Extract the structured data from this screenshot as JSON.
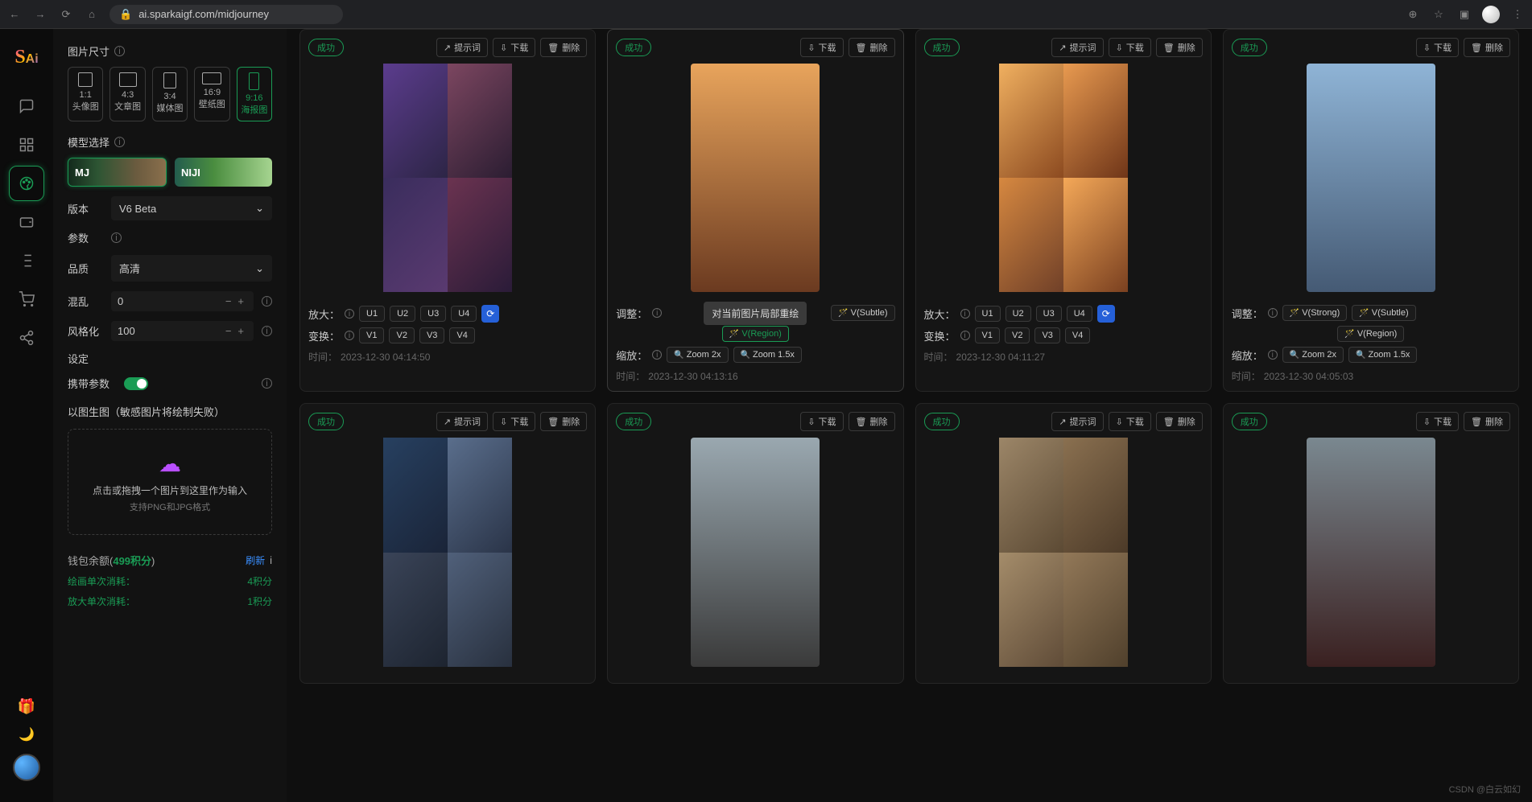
{
  "browser": {
    "url": "ai.sparkaigf.com/midjourney"
  },
  "sidebar": {
    "size_label": "图片尺寸",
    "sizes": [
      {
        "ratio": "1:1",
        "label": "头像图"
      },
      {
        "ratio": "4:3",
        "label": "文章图"
      },
      {
        "ratio": "3:4",
        "label": "媒体图"
      },
      {
        "ratio": "16:9",
        "label": "壁纸图"
      },
      {
        "ratio": "9:16",
        "label": "海报图"
      }
    ],
    "model_label": "模型选择",
    "models": {
      "mj": "MJ",
      "niji": "NIJI"
    },
    "version_label": "版本",
    "version_value": "V6 Beta",
    "params_label": "参数",
    "quality_label": "品质",
    "quality_value": "高清",
    "chaos_label": "混乱",
    "chaos_value": "0",
    "style_label": "风格化",
    "style_value": "100",
    "settings_label": "设定",
    "carry_label": "携带参数",
    "img2img_label": "以图生图（敏感图片将绘制失败）",
    "upload_l1": "点击或拖拽一个图片到这里作为输入",
    "upload_l2": "支持PNG和JPG格式",
    "wallet_label": "钱包余额(",
    "wallet_points": "499积分",
    "wallet_close": ")",
    "refresh": "刷新",
    "cost_draw_label": "绘画单次消耗：",
    "cost_draw_val": "4积分",
    "cost_upscale_label": "放大单次消耗：",
    "cost_upscale_val": "1积分"
  },
  "labels": {
    "success": "成功",
    "prompt": "提示词",
    "download": "下载",
    "delete": "删除",
    "upscale": "放大：",
    "variation": "变换：",
    "adjust": "调整：",
    "zoom": "缩放：",
    "time": "时间：",
    "u1": "U1",
    "u2": "U2",
    "u3": "U3",
    "u4": "U4",
    "v1": "V1",
    "v2": "V2",
    "v3": "V3",
    "v4": "V4",
    "vstrong": "V(Strong)",
    "vsubtle": "V(Subtle)",
    "vregion": "V(Region)",
    "zoom2": "Zoom 2x",
    "zoom15": "Zoom 1.5x",
    "tooltip_region": "对当前图片局部重绘"
  },
  "cards": [
    {
      "type": "grid",
      "actions": [
        "prompt",
        "download",
        "delete"
      ],
      "controls": "upscale",
      "time": "2023-12-30 04:14:50"
    },
    {
      "type": "single",
      "actions": [
        "download",
        "delete"
      ],
      "controls": "adjust",
      "time": "2023-12-30 04:13:16",
      "tooltip": true
    },
    {
      "type": "grid",
      "actions": [
        "prompt",
        "download",
        "delete"
      ],
      "controls": "upscale",
      "time": "2023-12-30 04:11:27"
    },
    {
      "type": "single",
      "actions": [
        "download",
        "delete"
      ],
      "controls": "adjust",
      "time": "2023-12-30 04:05:03"
    },
    {
      "type": "grid",
      "actions": [
        "prompt",
        "download",
        "delete"
      ]
    },
    {
      "type": "single",
      "actions": [
        "download",
        "delete"
      ]
    },
    {
      "type": "grid",
      "actions": [
        "prompt",
        "download",
        "delete"
      ]
    },
    {
      "type": "single",
      "actions": [
        "download",
        "delete"
      ]
    }
  ],
  "watermark": "CSDN @白云如幻"
}
